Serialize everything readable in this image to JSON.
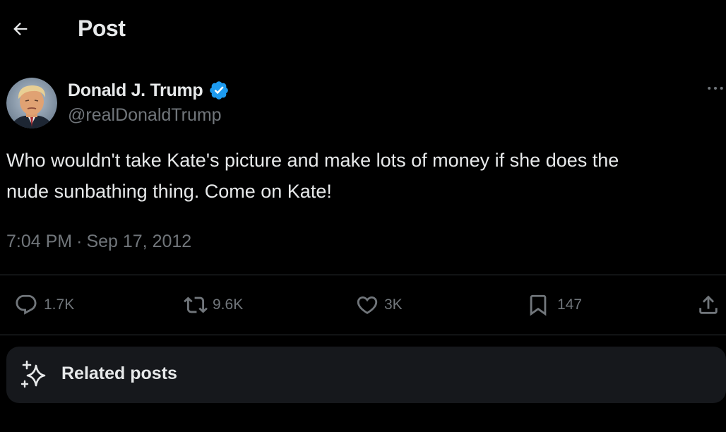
{
  "header": {
    "back_icon": "arrow-left-icon",
    "title": "Post"
  },
  "author": {
    "avatar_icon": "avatar",
    "display_name": "Donald J. Trump",
    "verified_icon": "verified-badge-icon",
    "handle": "@realDonaldTrump",
    "more_icon": "more-horizontal-icon"
  },
  "tweet": {
    "text": "Who wouldn't take Kate's picture and make lots of money if she does the\nnude sunbathing thing. Come on Kate!",
    "time": "7:04 PM",
    "separator": "·",
    "date": "Sep 17, 2012"
  },
  "actions": {
    "reply": {
      "icon": "reply-icon",
      "count": "1.7K"
    },
    "repost": {
      "icon": "repost-icon",
      "count": "9.6K"
    },
    "like": {
      "icon": "heart-icon",
      "count": "3K"
    },
    "bookmark": {
      "icon": "bookmark-icon",
      "count": "147"
    },
    "share": {
      "icon": "share-icon"
    }
  },
  "related": {
    "icon": "sparkle-icon",
    "label": "Related posts"
  },
  "colors": {
    "background": "#000000",
    "text_primary": "#e7e9ea",
    "text_secondary": "#71767b",
    "verified_blue": "#1d9bf0",
    "divider": "#2f3336",
    "card": "#16181c"
  }
}
